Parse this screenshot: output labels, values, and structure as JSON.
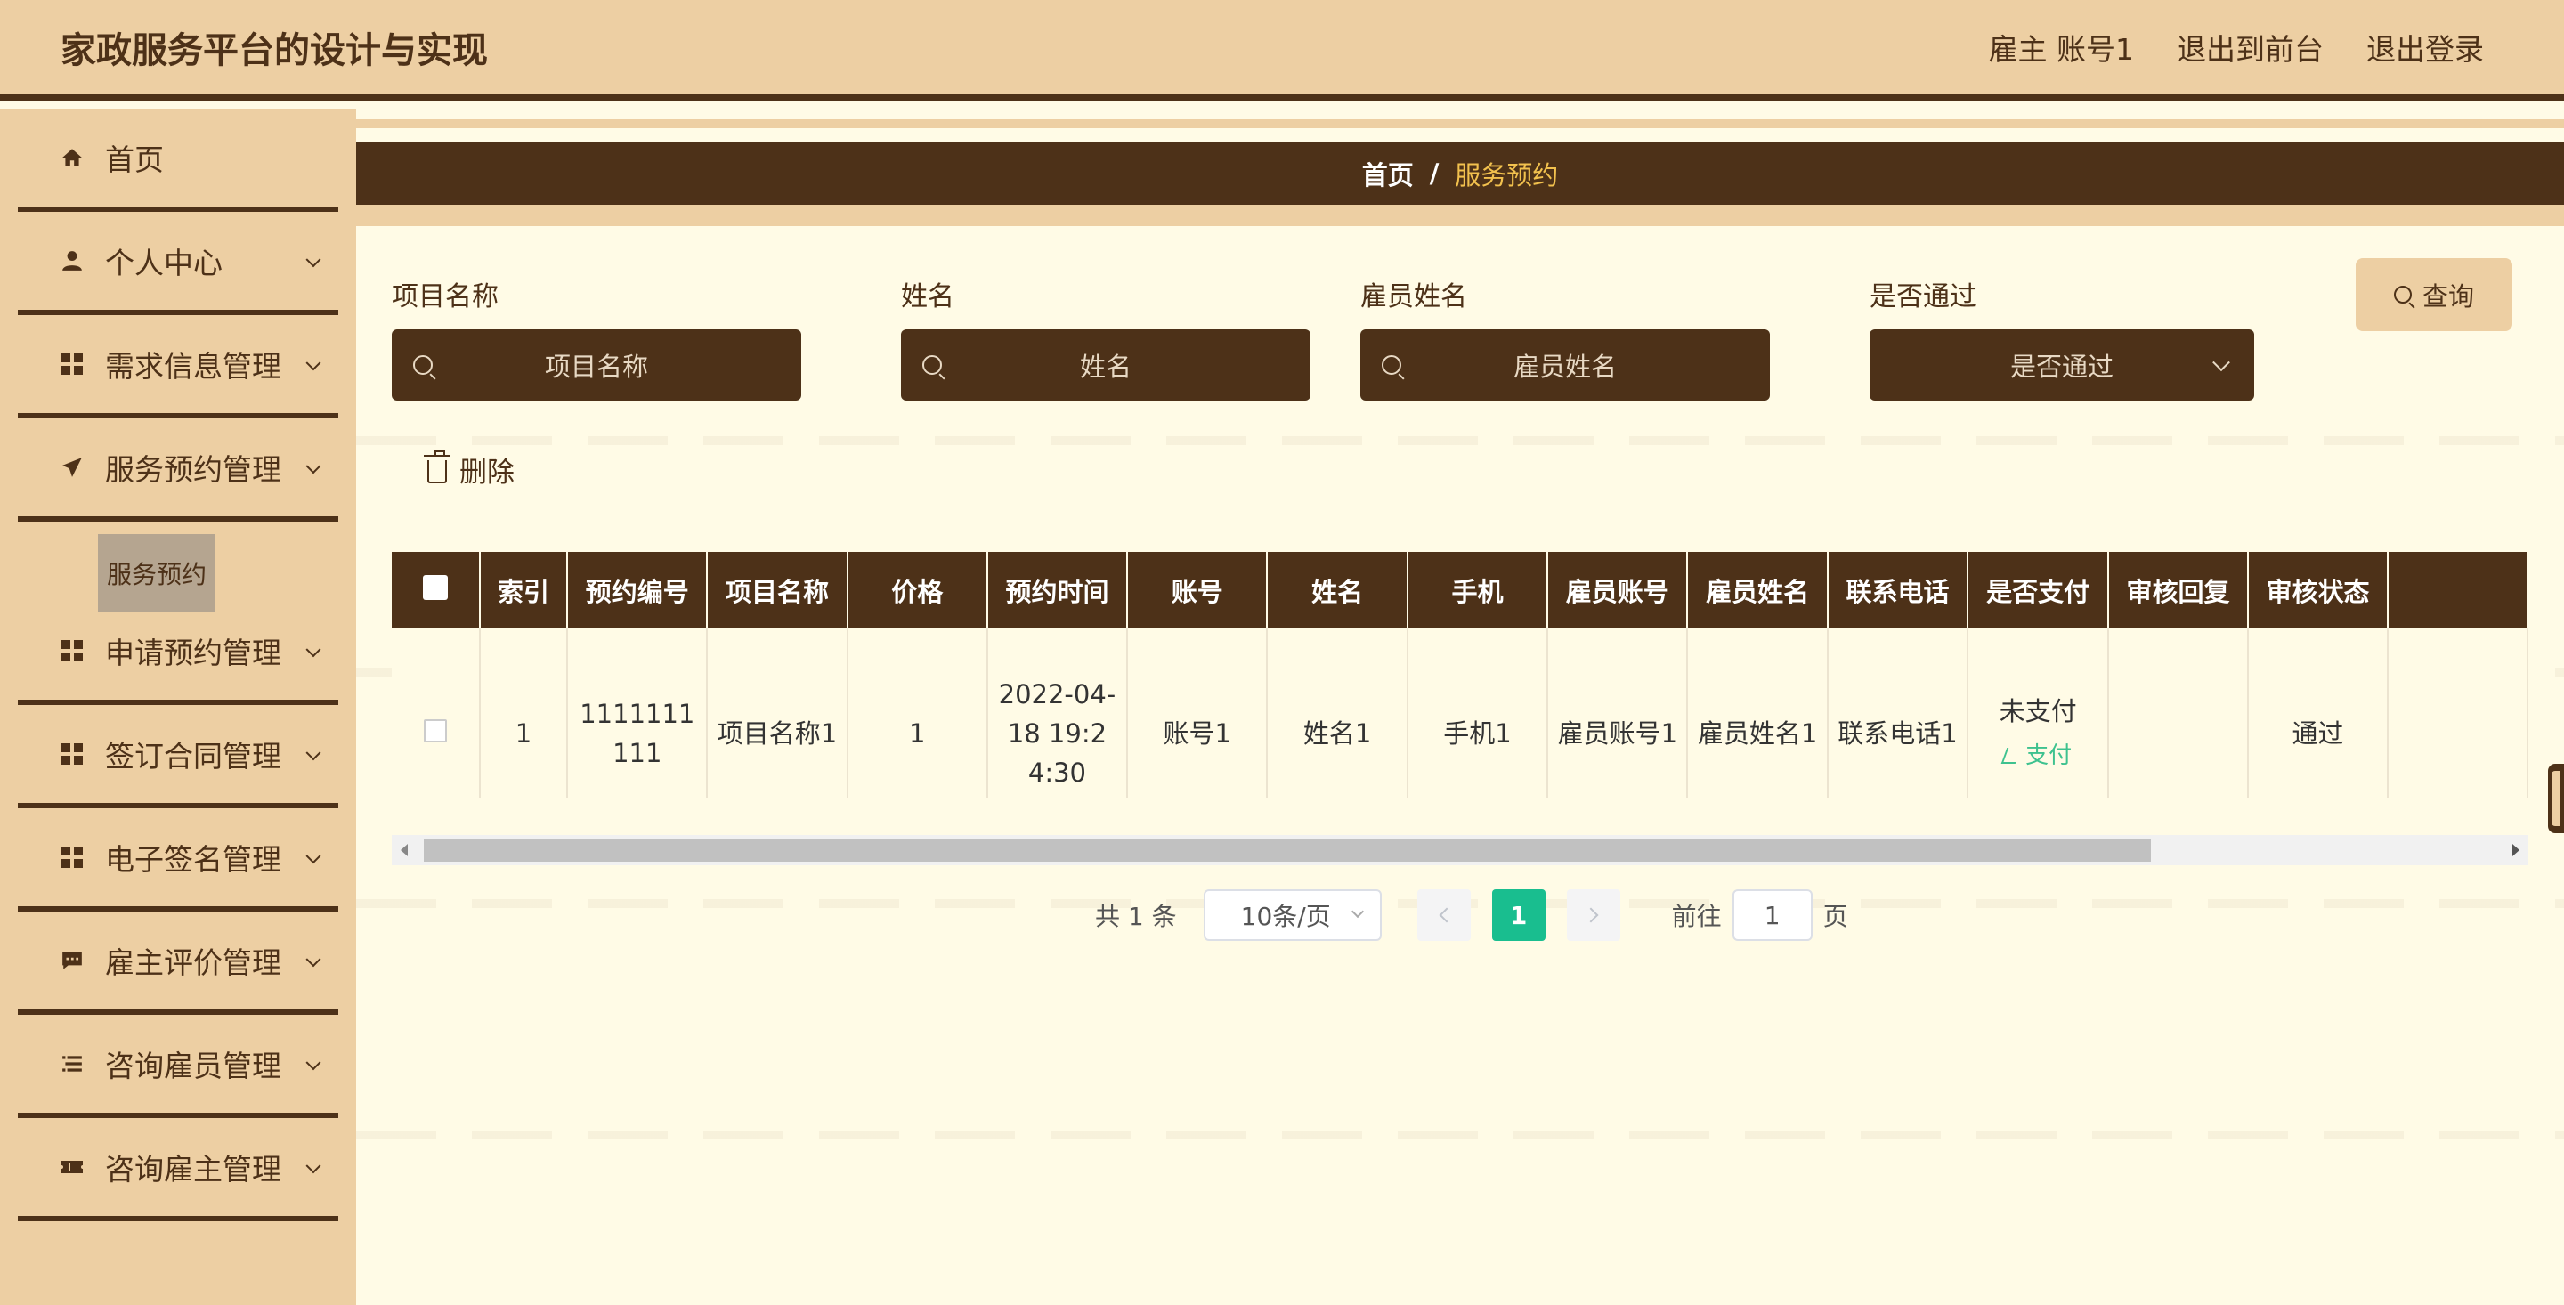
{
  "header": {
    "title": "家政服务平台的设计与实现",
    "user_label": "雇主 账号1",
    "to_front": "退出到前台",
    "logout": "退出登录"
  },
  "sidebar": {
    "items": [
      {
        "label": "首页",
        "icon": "home-icon"
      },
      {
        "label": "个人中心",
        "icon": "user-icon"
      },
      {
        "label": "需求信息管理",
        "icon": "grid-icon"
      },
      {
        "label": "服务预约管理",
        "icon": "send-icon"
      },
      {
        "label": "申请预约管理",
        "icon": "grid-icon"
      },
      {
        "label": "签订合同管理",
        "icon": "grid-icon"
      },
      {
        "label": "电子签名管理",
        "icon": "grid-icon"
      },
      {
        "label": "雇主评价管理",
        "icon": "chat-icon"
      },
      {
        "label": "咨询雇员管理",
        "icon": "list-icon"
      },
      {
        "label": "咨询雇主管理",
        "icon": "ticket-icon"
      }
    ],
    "submenu": {
      "label": "服务预约"
    }
  },
  "breadcrumb": {
    "home": "首页",
    "sep": "/",
    "current": "服务预约"
  },
  "search": {
    "project": {
      "label": "项目名称",
      "placeholder": "项目名称"
    },
    "name": {
      "label": "姓名",
      "placeholder": "姓名"
    },
    "employee_name": {
      "label": "雇员姓名",
      "placeholder": "雇员姓名"
    },
    "passed": {
      "label": "是否通过",
      "placeholder": "是否通过"
    },
    "query_button": "查询"
  },
  "actions": {
    "delete": "删除"
  },
  "table": {
    "headers": [
      "索引",
      "预约编号",
      "项目名称",
      "价格",
      "预约时间",
      "账号",
      "姓名",
      "手机",
      "雇员账号",
      "雇员姓名",
      "联系电话",
      "是否支付",
      "审核回复",
      "审核状态"
    ],
    "rows": [
      {
        "index": "1",
        "order_no": "1111111111",
        "project": "项目名称1",
        "price": "1",
        "time": "2022-04-18 19:24:30",
        "account": "账号1",
        "name": "姓名1",
        "phone": "手机1",
        "employee_account": "雇员账号1",
        "employee_name": "雇员姓名1",
        "contact": "联系电话1",
        "paid": "未支付",
        "pay_action": "支付",
        "reply": "",
        "status": "通过"
      }
    ]
  },
  "pagination": {
    "total": "共 1 条",
    "page_size": "10条/页",
    "current": "1",
    "goto_prefix": "前往",
    "goto_value": "1",
    "goto_suffix": "页"
  },
  "colors": {
    "brown": "#4d3118",
    "tan": "#edcfa3",
    "cream": "#fffbe6",
    "green": "#19be8f",
    "gold": "#f2c14e"
  }
}
